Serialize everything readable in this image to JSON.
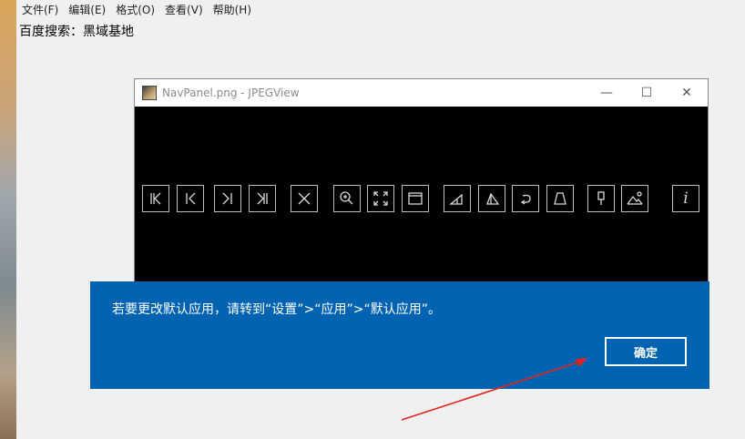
{
  "notepad": {
    "menu": [
      "文件(F)",
      "编辑(E)",
      "格式(O)",
      "查看(V)",
      "帮助(H)"
    ],
    "content": "百度搜索：黑域基地"
  },
  "viewer": {
    "title": "NavPanel.png - JPEGView",
    "minimize": "—",
    "maximize": "☐",
    "close": "✕",
    "nav_icons": [
      "first-image-icon",
      "previous-image-icon",
      "next-image-icon",
      "last-image-icon",
      "delete-icon",
      "zoom-icon",
      "fit-screen-icon",
      "window-icon",
      "rotate-right-icon",
      "rotate-left-icon",
      "undo-rotation-icon",
      "perspective-icon",
      "pin-icon",
      "image-adjust-icon",
      "info-icon"
    ]
  },
  "dialog": {
    "message": "若要更改默认应用，请转到“设置”>“应用”>“默认应用”。",
    "ok_label": "确定",
    "color": "#0063b1"
  },
  "annotation": {
    "arrow_color": "#e0231c"
  }
}
